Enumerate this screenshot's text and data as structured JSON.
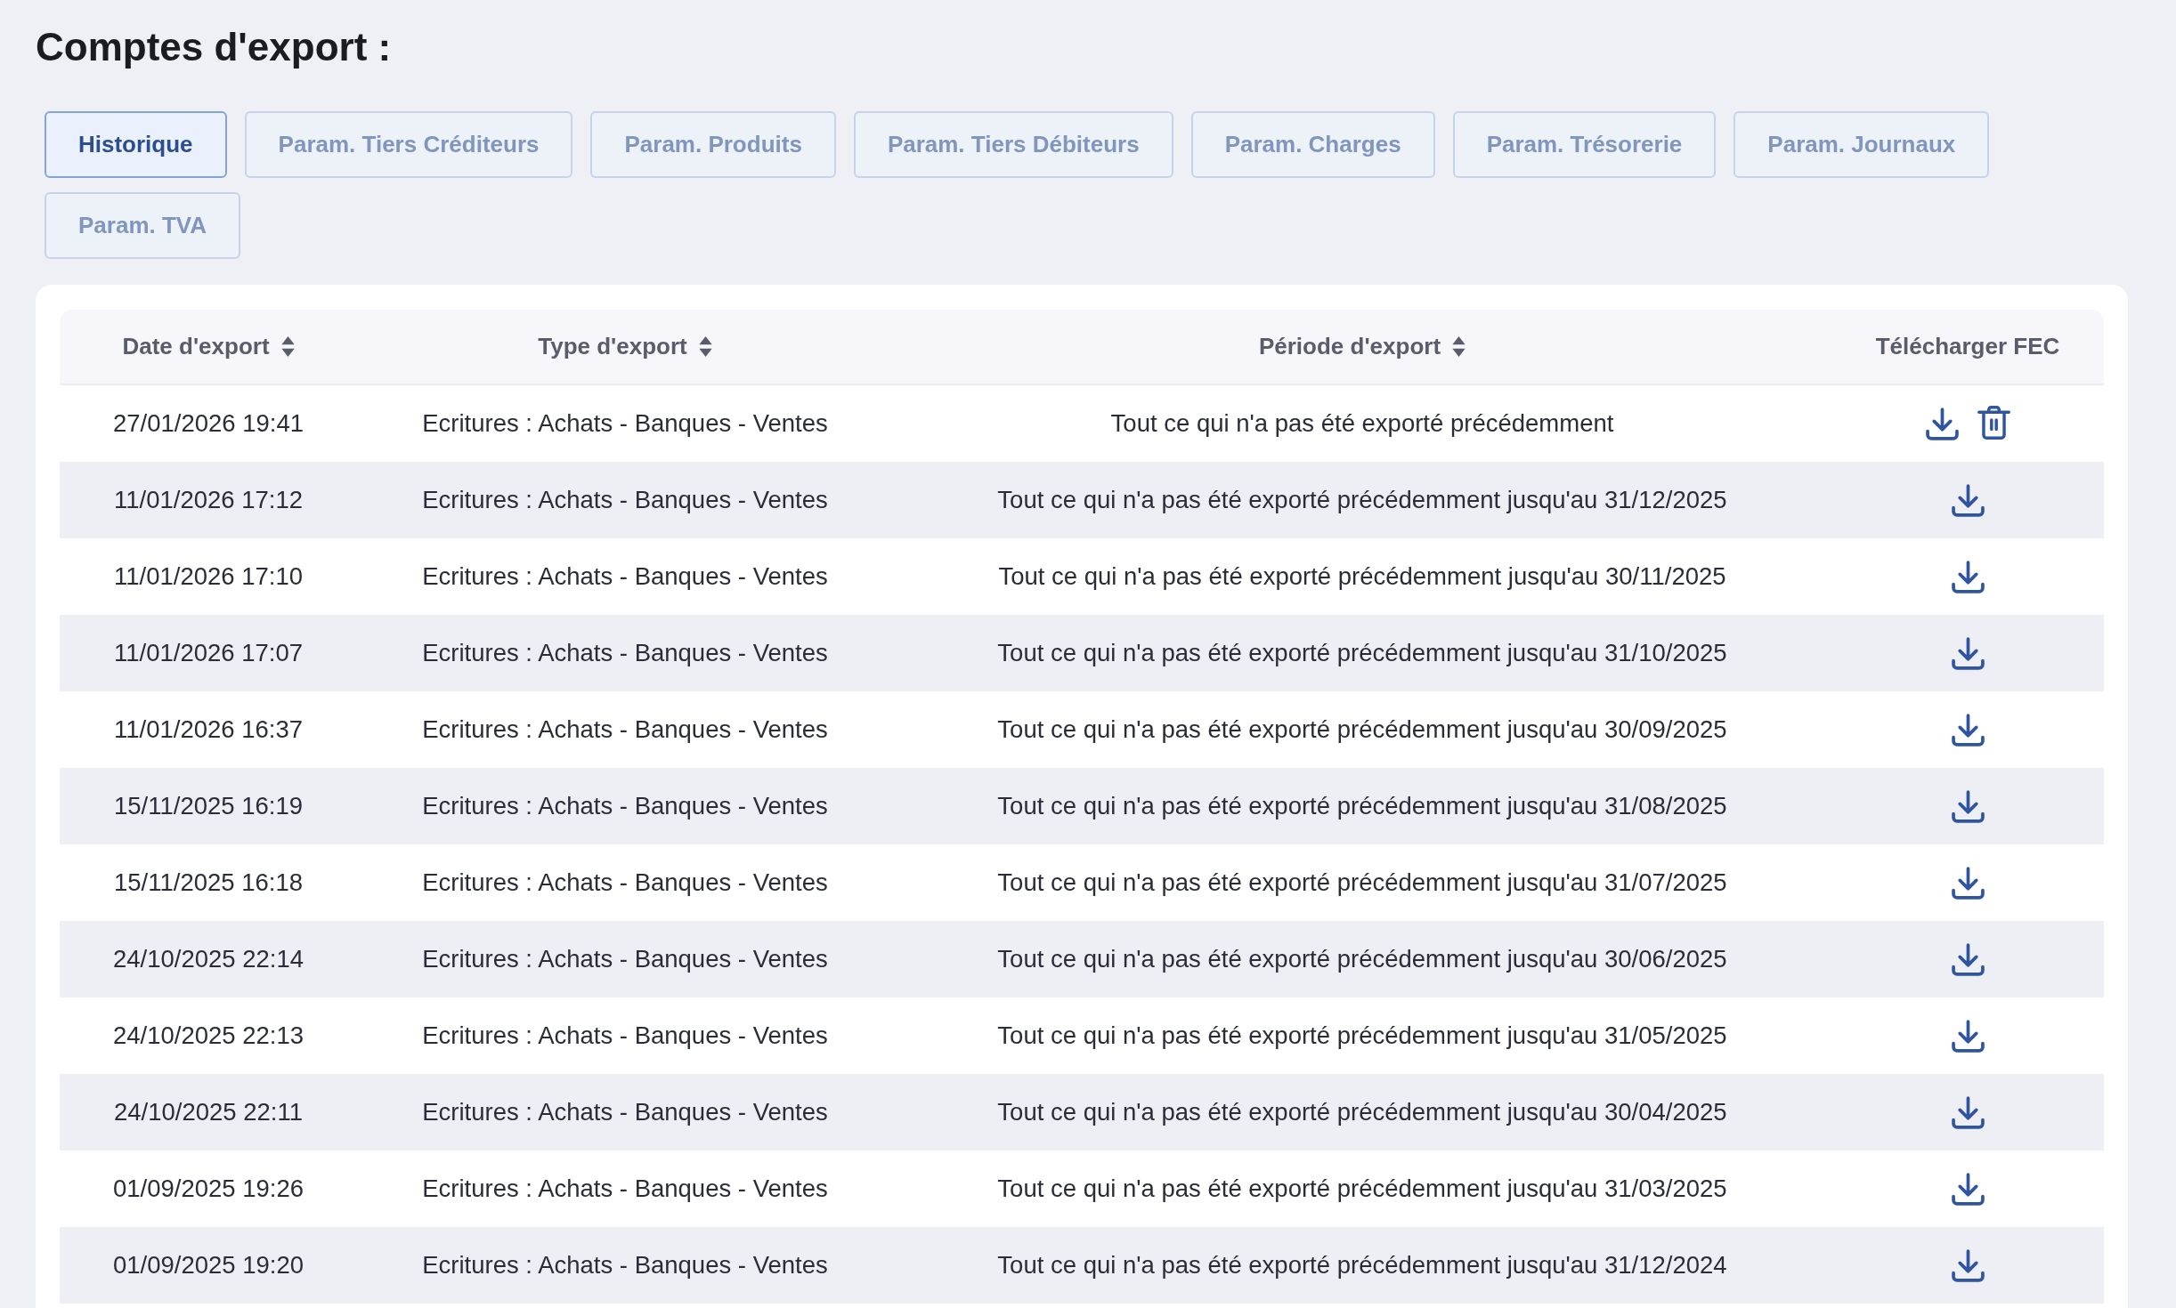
{
  "page": {
    "title": "Comptes d'export :"
  },
  "tabs": [
    {
      "label": "Historique",
      "selected": true
    },
    {
      "label": "Param. Tiers Créditeurs",
      "selected": false
    },
    {
      "label": "Param. Produits",
      "selected": false
    },
    {
      "label": "Param. Tiers Débiteurs",
      "selected": false
    },
    {
      "label": "Param. Charges",
      "selected": false
    },
    {
      "label": "Param. Trésorerie",
      "selected": false
    },
    {
      "label": "Param. Journaux",
      "selected": false
    },
    {
      "label": "Param. TVA",
      "selected": false
    }
  ],
  "table": {
    "columns": [
      {
        "label": "Date d'export",
        "sortable": true
      },
      {
        "label": "Type d'export",
        "sortable": true
      },
      {
        "label": "Période d'export",
        "sortable": true
      },
      {
        "label": "Télécharger FEC",
        "sortable": false
      }
    ],
    "rows": [
      {
        "date": "27/01/2026 19:41",
        "type": "Ecritures : Achats - Banques - Ventes",
        "period": "Tout ce qui n'a pas été exporté précédemment",
        "deletable": true
      },
      {
        "date": "11/01/2026 17:12",
        "type": "Ecritures : Achats - Banques - Ventes",
        "period": "Tout ce qui n'a pas été exporté précédemment jusqu'au 31/12/2025",
        "deletable": false
      },
      {
        "date": "11/01/2026 17:10",
        "type": "Ecritures : Achats - Banques - Ventes",
        "period": "Tout ce qui n'a pas été exporté précédemment jusqu'au 30/11/2025",
        "deletable": false
      },
      {
        "date": "11/01/2026 17:07",
        "type": "Ecritures : Achats - Banques - Ventes",
        "period": "Tout ce qui n'a pas été exporté précédemment jusqu'au 31/10/2025",
        "deletable": false
      },
      {
        "date": "11/01/2026 16:37",
        "type": "Ecritures : Achats - Banques - Ventes",
        "period": "Tout ce qui n'a pas été exporté précédemment jusqu'au 30/09/2025",
        "deletable": false
      },
      {
        "date": "15/11/2025 16:19",
        "type": "Ecritures : Achats - Banques - Ventes",
        "period": "Tout ce qui n'a pas été exporté précédemment jusqu'au 31/08/2025",
        "deletable": false
      },
      {
        "date": "15/11/2025 16:18",
        "type": "Ecritures : Achats - Banques - Ventes",
        "period": "Tout ce qui n'a pas été exporté précédemment jusqu'au 31/07/2025",
        "deletable": false
      },
      {
        "date": "24/10/2025 22:14",
        "type": "Ecritures : Achats - Banques - Ventes",
        "period": "Tout ce qui n'a pas été exporté précédemment jusqu'au 30/06/2025",
        "deletable": false
      },
      {
        "date": "24/10/2025 22:13",
        "type": "Ecritures : Achats - Banques - Ventes",
        "period": "Tout ce qui n'a pas été exporté précédemment jusqu'au 31/05/2025",
        "deletable": false
      },
      {
        "date": "24/10/2025 22:11",
        "type": "Ecritures : Achats - Banques - Ventes",
        "period": "Tout ce qui n'a pas été exporté précédemment jusqu'au 30/04/2025",
        "deletable": false
      },
      {
        "date": "01/09/2025 19:26",
        "type": "Ecritures : Achats - Banques - Ventes",
        "period": "Tout ce qui n'a pas été exporté précédemment jusqu'au 31/03/2025",
        "deletable": false
      },
      {
        "date": "01/09/2025 19:20",
        "type": "Ecritures : Achats - Banques - Ventes",
        "period": "Tout ce qui n'a pas été exporté précédemment jusqu'au 31/12/2024",
        "deletable": false
      }
    ]
  }
}
